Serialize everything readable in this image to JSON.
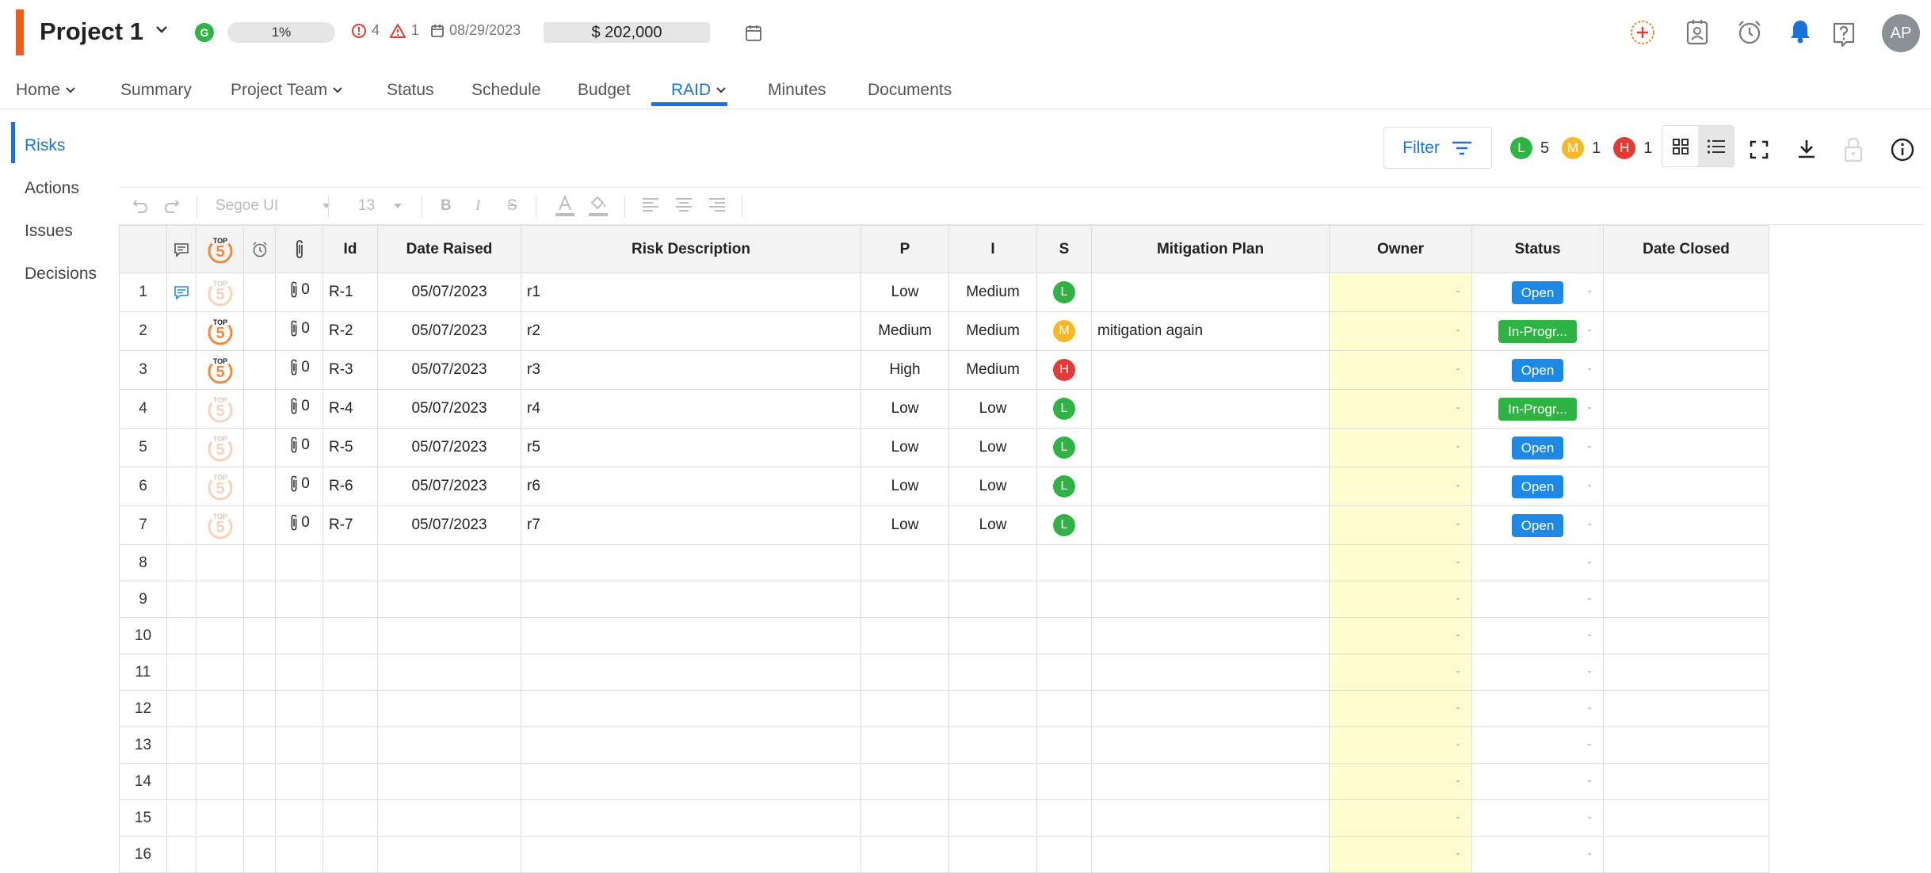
{
  "header": {
    "project_title": "Project 1",
    "health_letter": "G",
    "progress": "1%",
    "issue_count": "4",
    "risk_count": "1",
    "date": "08/29/2023",
    "budget": "$ 202,000",
    "avatar_initials": "AP"
  },
  "nav": {
    "tabs": [
      {
        "label": "Home",
        "dropdown": true
      },
      {
        "label": "Summary"
      },
      {
        "label": "Project Team",
        "dropdown": true
      },
      {
        "label": "Status"
      },
      {
        "label": "Schedule"
      },
      {
        "label": "Budget"
      },
      {
        "label": "RAID",
        "dropdown": true,
        "active": true
      },
      {
        "label": "Minutes"
      },
      {
        "label": "Documents"
      }
    ]
  },
  "sidebar": {
    "items": [
      {
        "label": "Risks",
        "active": true
      },
      {
        "label": "Actions"
      },
      {
        "label": "Issues"
      },
      {
        "label": "Decisions"
      }
    ]
  },
  "toolbar": {
    "filter_label": "Filter",
    "severity_counts": [
      {
        "letter": "L",
        "count": "5",
        "color": "#2fb344"
      },
      {
        "letter": "M",
        "count": "1",
        "color": "#f5b928"
      },
      {
        "letter": "H",
        "count": "1",
        "color": "#e53935"
      }
    ]
  },
  "format_toolbar": {
    "font": "Segoe UI",
    "size": "13"
  },
  "grid": {
    "columns": [
      "",
      "",
      "",
      "",
      "",
      "Id",
      "Date Raised",
      "Risk Description",
      "P",
      "I",
      "S",
      "Mitigation Plan",
      "Owner",
      "Status",
      "Date Closed"
    ],
    "rows": [
      {
        "n": "1",
        "has_comment": true,
        "top5": false,
        "attachments": "0",
        "id": "R-1",
        "date_raised": "05/07/2023",
        "description": "r1",
        "p": "Low",
        "i": "Medium",
        "s": "L",
        "s_color": "#2fb344",
        "mitigation": "",
        "owner": "",
        "status": "Open",
        "status_type": "open",
        "date_closed": ""
      },
      {
        "n": "2",
        "has_comment": false,
        "top5": true,
        "attachments": "0",
        "id": "R-2",
        "date_raised": "05/07/2023",
        "description": "r2",
        "p": "Medium",
        "i": "Medium",
        "s": "M",
        "s_color": "#f5b928",
        "mitigation": "mitigation again",
        "owner": "",
        "status": "In-Progr...",
        "status_type": "progress",
        "date_closed": ""
      },
      {
        "n": "3",
        "has_comment": false,
        "top5": true,
        "attachments": "0",
        "id": "R-3",
        "date_raised": "05/07/2023",
        "description": "r3",
        "p": "High",
        "i": "Medium",
        "s": "H",
        "s_color": "#e53935",
        "mitigation": "",
        "owner": "",
        "status": "Open",
        "status_type": "open",
        "date_closed": ""
      },
      {
        "n": "4",
        "has_comment": false,
        "top5": false,
        "attachments": "0",
        "id": "R-4",
        "date_raised": "05/07/2023",
        "description": "r4",
        "p": "Low",
        "i": "Low",
        "s": "L",
        "s_color": "#2fb344",
        "mitigation": "",
        "owner": "",
        "status": "In-Progr...",
        "status_type": "progress",
        "date_closed": ""
      },
      {
        "n": "5",
        "has_comment": false,
        "top5": false,
        "attachments": "0",
        "id": "R-5",
        "date_raised": "05/07/2023",
        "description": "r5",
        "p": "Low",
        "i": "Low",
        "s": "L",
        "s_color": "#2fb344",
        "mitigation": "",
        "owner": "",
        "status": "Open",
        "status_type": "open",
        "date_closed": ""
      },
      {
        "n": "6",
        "has_comment": false,
        "top5": false,
        "attachments": "0",
        "id": "R-6",
        "date_raised": "05/07/2023",
        "description": "r6",
        "p": "Low",
        "i": "Low",
        "s": "L",
        "s_color": "#2fb344",
        "mitigation": "",
        "owner": "",
        "status": "Open",
        "status_type": "open",
        "date_closed": ""
      },
      {
        "n": "7",
        "has_comment": false,
        "top5": false,
        "attachments": "0",
        "id": "R-7",
        "date_raised": "05/07/2023",
        "description": "r7",
        "p": "Low",
        "i": "Low",
        "s": "L",
        "s_color": "#2fb344",
        "mitigation": "",
        "owner": "",
        "status": "Open",
        "status_type": "open",
        "date_closed": ""
      }
    ],
    "empty_rows": [
      "8",
      "9",
      "10",
      "11",
      "12",
      "13",
      "14",
      "15",
      "16"
    ]
  }
}
